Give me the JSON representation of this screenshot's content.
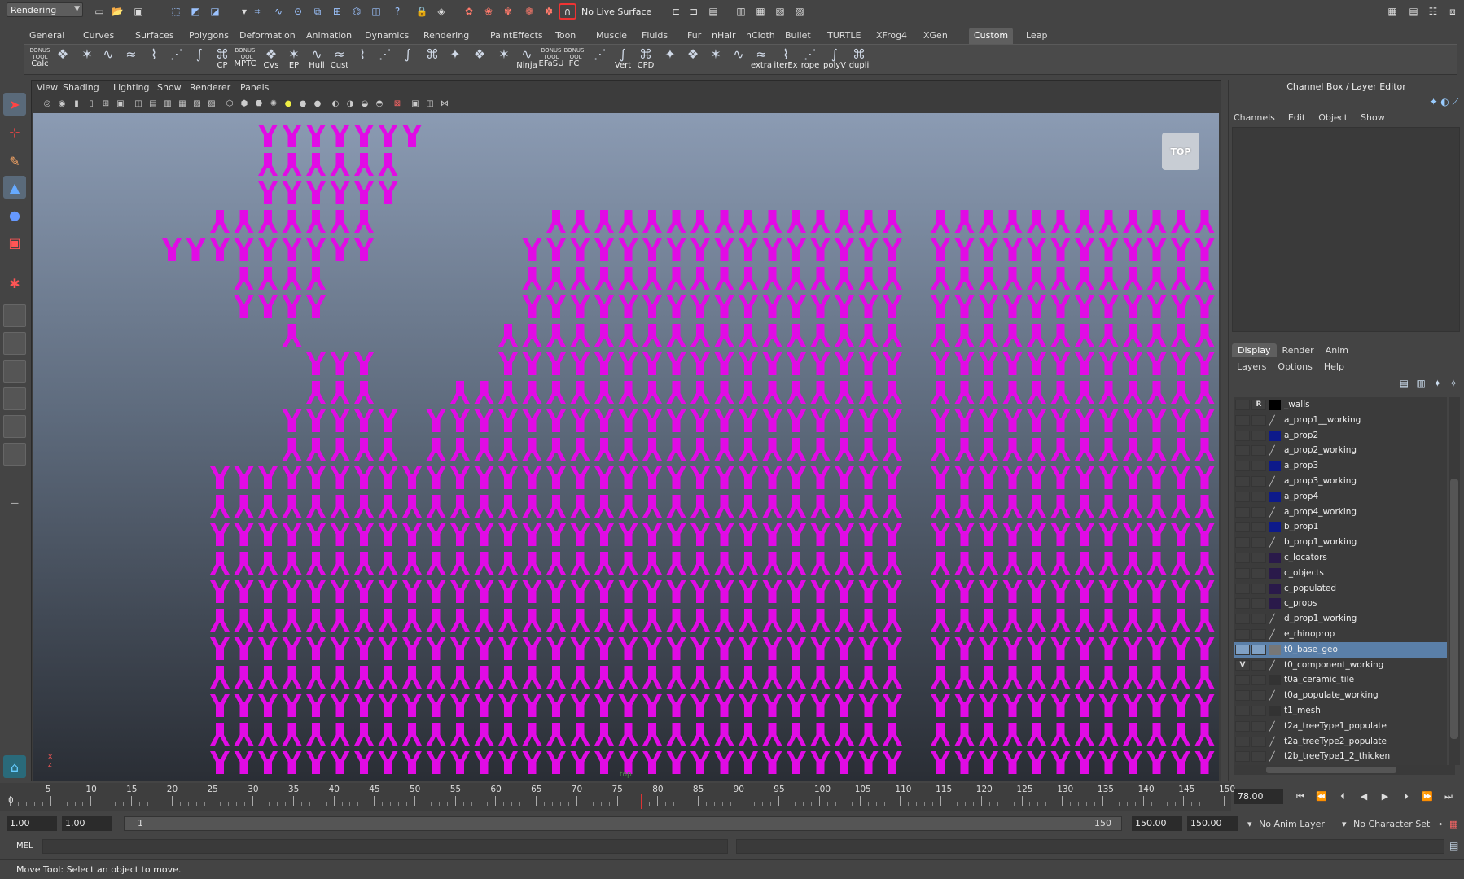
{
  "status_line": {
    "menu_set": "Rendering",
    "live_surface": "No Live Surface"
  },
  "shelf": {
    "tabs": [
      "General",
      "Curves",
      "Surfaces",
      "Polygons",
      "Deformation",
      "Animation",
      "Dynamics",
      "Rendering",
      "PaintEffects",
      "Toon",
      "Muscle",
      "Fluids",
      "Fur",
      "nHair",
      "nCloth",
      "Bullet",
      "TURTLE",
      "XFrog4",
      "XGen",
      "Custom",
      "Leap"
    ],
    "active_tab": "Custom",
    "buttons": [
      {
        "icon": "bonus-calc-icon",
        "label": "Calc",
        "top": "BONUS TOOL"
      },
      {
        "icon": "shelf-tool-icon",
        "label": "",
        "top": ""
      },
      {
        "icon": "star-icon",
        "label": "",
        "top": ""
      },
      {
        "icon": "curve-icon",
        "label": "",
        "top": ""
      },
      {
        "icon": "curve2-icon",
        "label": "",
        "top": ""
      },
      {
        "icon": "curve3-icon",
        "label": "",
        "top": ""
      },
      {
        "icon": "curve4-icon",
        "label": "",
        "top": ""
      },
      {
        "icon": "curve5-icon",
        "label": "",
        "top": ""
      },
      {
        "icon": "cp-icon",
        "label": "CP",
        "top": ""
      },
      {
        "icon": "bonus-mptc-icon",
        "label": "MPTC",
        "top": "BONUS TOOL"
      },
      {
        "icon": "cvs-icon",
        "label": "CVs",
        "top": ""
      },
      {
        "icon": "ep-icon",
        "label": "EP",
        "top": ""
      },
      {
        "icon": "hull-icon",
        "label": "Hull",
        "top": ""
      },
      {
        "icon": "cust-icon",
        "label": "Cust",
        "top": ""
      },
      {
        "icon": "tool-a-icon",
        "label": "",
        "top": ""
      },
      {
        "icon": "tool-b-icon",
        "label": "",
        "top": ""
      },
      {
        "icon": "tool-c-icon",
        "label": "",
        "top": ""
      },
      {
        "icon": "tool-d-icon",
        "label": "",
        "top": ""
      },
      {
        "icon": "tool-e-icon",
        "label": "",
        "top": ""
      },
      {
        "icon": "tool-f-icon",
        "label": "",
        "top": ""
      },
      {
        "icon": "tool-g-icon",
        "label": "",
        "top": ""
      },
      {
        "icon": "ninja-icon",
        "label": "Ninja",
        "top": ""
      },
      {
        "icon": "bonus-efasu-icon",
        "label": "EFaSU",
        "top": "BONUS TOOL"
      },
      {
        "icon": "bonus-fc-icon",
        "label": "FC",
        "top": "BONUS TOOL"
      },
      {
        "icon": "cube-icon",
        "label": "",
        "top": ""
      },
      {
        "icon": "vert-icon",
        "label": "Vert",
        "top": ""
      },
      {
        "icon": "cpd-icon",
        "label": "CPD",
        "top": ""
      },
      {
        "icon": "tool-h-icon",
        "label": "",
        "top": ""
      },
      {
        "icon": "tool-i-icon",
        "label": "",
        "top": ""
      },
      {
        "icon": "tool-j-icon",
        "label": "",
        "top": ""
      },
      {
        "icon": "tool-k-icon",
        "label": "",
        "top": ""
      },
      {
        "icon": "extra-icon",
        "label": "extra",
        "top": ""
      },
      {
        "icon": "itere-icon",
        "label": "iterEx",
        "top": ""
      },
      {
        "icon": "rope-icon",
        "label": "rope",
        "top": ""
      },
      {
        "icon": "polyv-icon",
        "label": "polyV",
        "top": ""
      },
      {
        "icon": "dupli-icon",
        "label": "dupli",
        "top": ""
      }
    ]
  },
  "panel": {
    "menus": [
      "View",
      "Shading",
      "Lighting",
      "Show",
      "Renderer",
      "Panels"
    ],
    "viewcube": "TOP",
    "camera": "top",
    "pattern_color": "#e10be5"
  },
  "channel_box": {
    "title": "Channel Box / Layer Editor",
    "menus": [
      "Channels",
      "Edit",
      "Object",
      "Show"
    ]
  },
  "layer_editor": {
    "tabs": [
      "Display",
      "Render",
      "Anim"
    ],
    "active_tab": "Display",
    "menus": [
      "Layers",
      "Options",
      "Help"
    ],
    "layers": [
      {
        "name": "_walls",
        "v": "",
        "p": "R",
        "color": "#000000",
        "kind": "swatch"
      },
      {
        "name": "a_prop1__working",
        "v": "",
        "p": "",
        "color": "",
        "kind": "slash"
      },
      {
        "name": "a_prop2",
        "v": "",
        "p": "",
        "color": "#0d1a8a",
        "kind": "swatch"
      },
      {
        "name": "a_prop2_working",
        "v": "",
        "p": "",
        "color": "",
        "kind": "slash"
      },
      {
        "name": "a_prop3",
        "v": "",
        "p": "",
        "color": "#0d1a8a",
        "kind": "swatch"
      },
      {
        "name": "a_prop3_working",
        "v": "",
        "p": "",
        "color": "",
        "kind": "slash"
      },
      {
        "name": "a_prop4",
        "v": "",
        "p": "",
        "color": "#0d1a8a",
        "kind": "swatch"
      },
      {
        "name": "a_prop4_working",
        "v": "",
        "p": "",
        "color": "",
        "kind": "slash"
      },
      {
        "name": "b_prop1",
        "v": "",
        "p": "",
        "color": "#0d1a8a",
        "kind": "swatch"
      },
      {
        "name": "b_prop1_working",
        "v": "",
        "p": "",
        "color": "",
        "kind": "slash"
      },
      {
        "name": "c_locators",
        "v": "",
        "p": "",
        "color": "#2a1a4a",
        "kind": "swatch"
      },
      {
        "name": "c_objects",
        "v": "",
        "p": "",
        "color": "#2a1a4a",
        "kind": "swatch"
      },
      {
        "name": "c_populated",
        "v": "",
        "p": "",
        "color": "#2a1a4a",
        "kind": "swatch"
      },
      {
        "name": "c_props",
        "v": "",
        "p": "",
        "color": "#2a1a4a",
        "kind": "swatch"
      },
      {
        "name": "d_prop1_working",
        "v": "",
        "p": "",
        "color": "",
        "kind": "slash"
      },
      {
        "name": "e_rhinoprop",
        "v": "",
        "p": "",
        "color": "",
        "kind": "slash"
      },
      {
        "name": "t0_base_geo",
        "v": "",
        "p": "",
        "color": "#777777",
        "kind": "swatch",
        "selected": true
      },
      {
        "name": "t0_component_working",
        "v": "V",
        "p": "",
        "color": "",
        "kind": "slash"
      },
      {
        "name": "t0a_ceramic_tile",
        "v": "",
        "p": "",
        "color": "#333333",
        "kind": "swatch"
      },
      {
        "name": "t0a_populate_working",
        "v": "",
        "p": "",
        "color": "",
        "kind": "slash"
      },
      {
        "name": "t1_mesh",
        "v": "",
        "p": "",
        "color": "#333333",
        "kind": "swatch"
      },
      {
        "name": "t2a_treeType1_populate",
        "v": "",
        "p": "",
        "color": "",
        "kind": "slash"
      },
      {
        "name": "t2a_treeType2_populate",
        "v": "",
        "p": "",
        "color": "",
        "kind": "slash"
      },
      {
        "name": "t2b_treeType1_2_thicken",
        "v": "",
        "p": "",
        "color": "",
        "kind": "slash"
      }
    ]
  },
  "time_slider": {
    "ticks": [
      "0",
      "5",
      "10",
      "15",
      "20",
      "25",
      "30",
      "35",
      "40",
      "45",
      "50",
      "55",
      "60",
      "65",
      "70",
      "75",
      "80",
      "85",
      "90",
      "95",
      "100",
      "105",
      "110",
      "115",
      "120",
      "125",
      "130",
      "135",
      "140",
      "145",
      "150"
    ],
    "current_frame": "78.00"
  },
  "range_slider": {
    "start_time": "1.00",
    "playback_start": "1.00",
    "range_start": "1",
    "range_end": "150",
    "playback_end": "150.00",
    "end_time": "150.00",
    "anim_layer": "No Anim Layer",
    "character_set": "No Character Set"
  },
  "command_line": {
    "label": "MEL"
  },
  "help_line": {
    "text": "Move Tool: Select an object to move."
  }
}
